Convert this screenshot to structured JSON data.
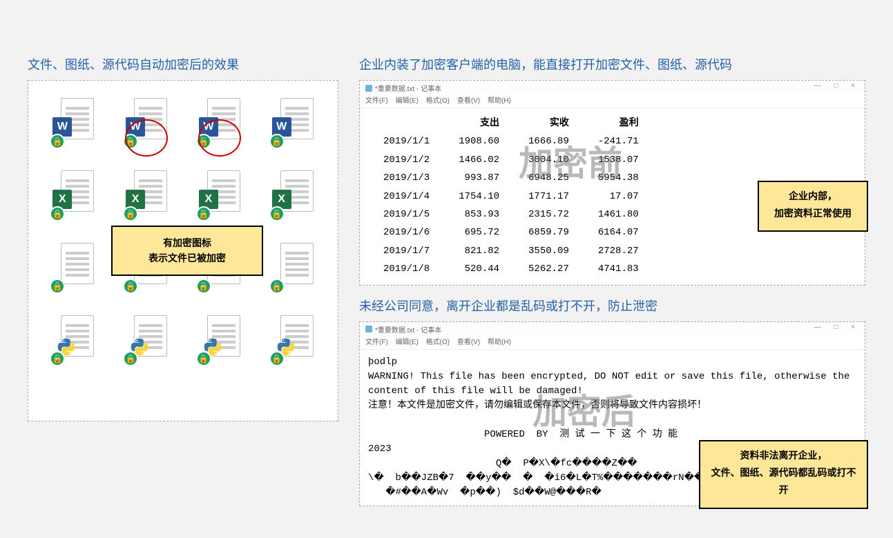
{
  "left": {
    "title": "文件、图纸、源代码自动加密后的效果",
    "tooltip_line1": "有加密图标",
    "tooltip_line2": "表示文件已被加密"
  },
  "right_top": {
    "title": "企业内装了加密客户端的电脑，能直接打开加密文件、图纸、源代码",
    "notepad_title": "*重要数据.txt - 记事本",
    "menu": {
      "file": "文件(F)",
      "edit": "编辑(E)",
      "format": "格式(O)",
      "view": "查看(V)",
      "help": "帮助(H)"
    },
    "watermark": "加密前",
    "callout_line1": "企业内部，",
    "callout_line2": "加密资料正常使用",
    "headers": {
      "col1": "支出",
      "col2": "实收",
      "col3": "盈利"
    },
    "rows": [
      {
        "date": "2019/1/1",
        "c1": "1908.60",
        "c2": "1666.89",
        "c3": "-241.71"
      },
      {
        "date": "2019/1/2",
        "c1": "1466.02",
        "c2": "3004.10",
        "c3": "1538.07"
      },
      {
        "date": "2019/1/3",
        "c1": "993.87",
        "c2": "6948.25",
        "c3": "5954.38"
      },
      {
        "date": "2019/1/4",
        "c1": "1754.10",
        "c2": "1771.17",
        "c3": "17.07"
      },
      {
        "date": "2019/1/5",
        "c1": "853.93",
        "c2": "2315.72",
        "c3": "1461.80"
      },
      {
        "date": "2019/1/6",
        "c1": "695.72",
        "c2": "6859.79",
        "c3": "6164.07"
      },
      {
        "date": "2019/1/7",
        "c1": "821.82",
        "c2": "3550.09",
        "c3": "2728.27"
      },
      {
        "date": "2019/1/8",
        "c1": "520.44",
        "c2": "5262.27",
        "c3": "4741.83"
      }
    ]
  },
  "right_bottom": {
    "title": "未经公司同意，离开企业都是乱码或打不开，防止泄密",
    "notepad_title": "*重要数据.txt - 记事本",
    "watermark": "加密后",
    "callout_line1": "资料非法离开企业，",
    "callout_line2": "文件、图纸、源代码都乱码或打不开",
    "body": "þodlp\nWARNING! This file has been encrypted, DO NOT edit or save this file, otherwise the\ncontent of this file will be damaged!\n注意！本文件是加密文件，请勿编辑或保存本文件，否则将导致文件内容损坏！\n\n                    POWERED  BY  测 试 一 下 这 个 功 能\n2023\n                      Q�  P�X\\�fc����Z��\n\\�  b��JZB�7  ��y��  �  �i6�L�T%�������rN����\n   �#��A�Wv  �p��)  $d��W@���R�"
  }
}
